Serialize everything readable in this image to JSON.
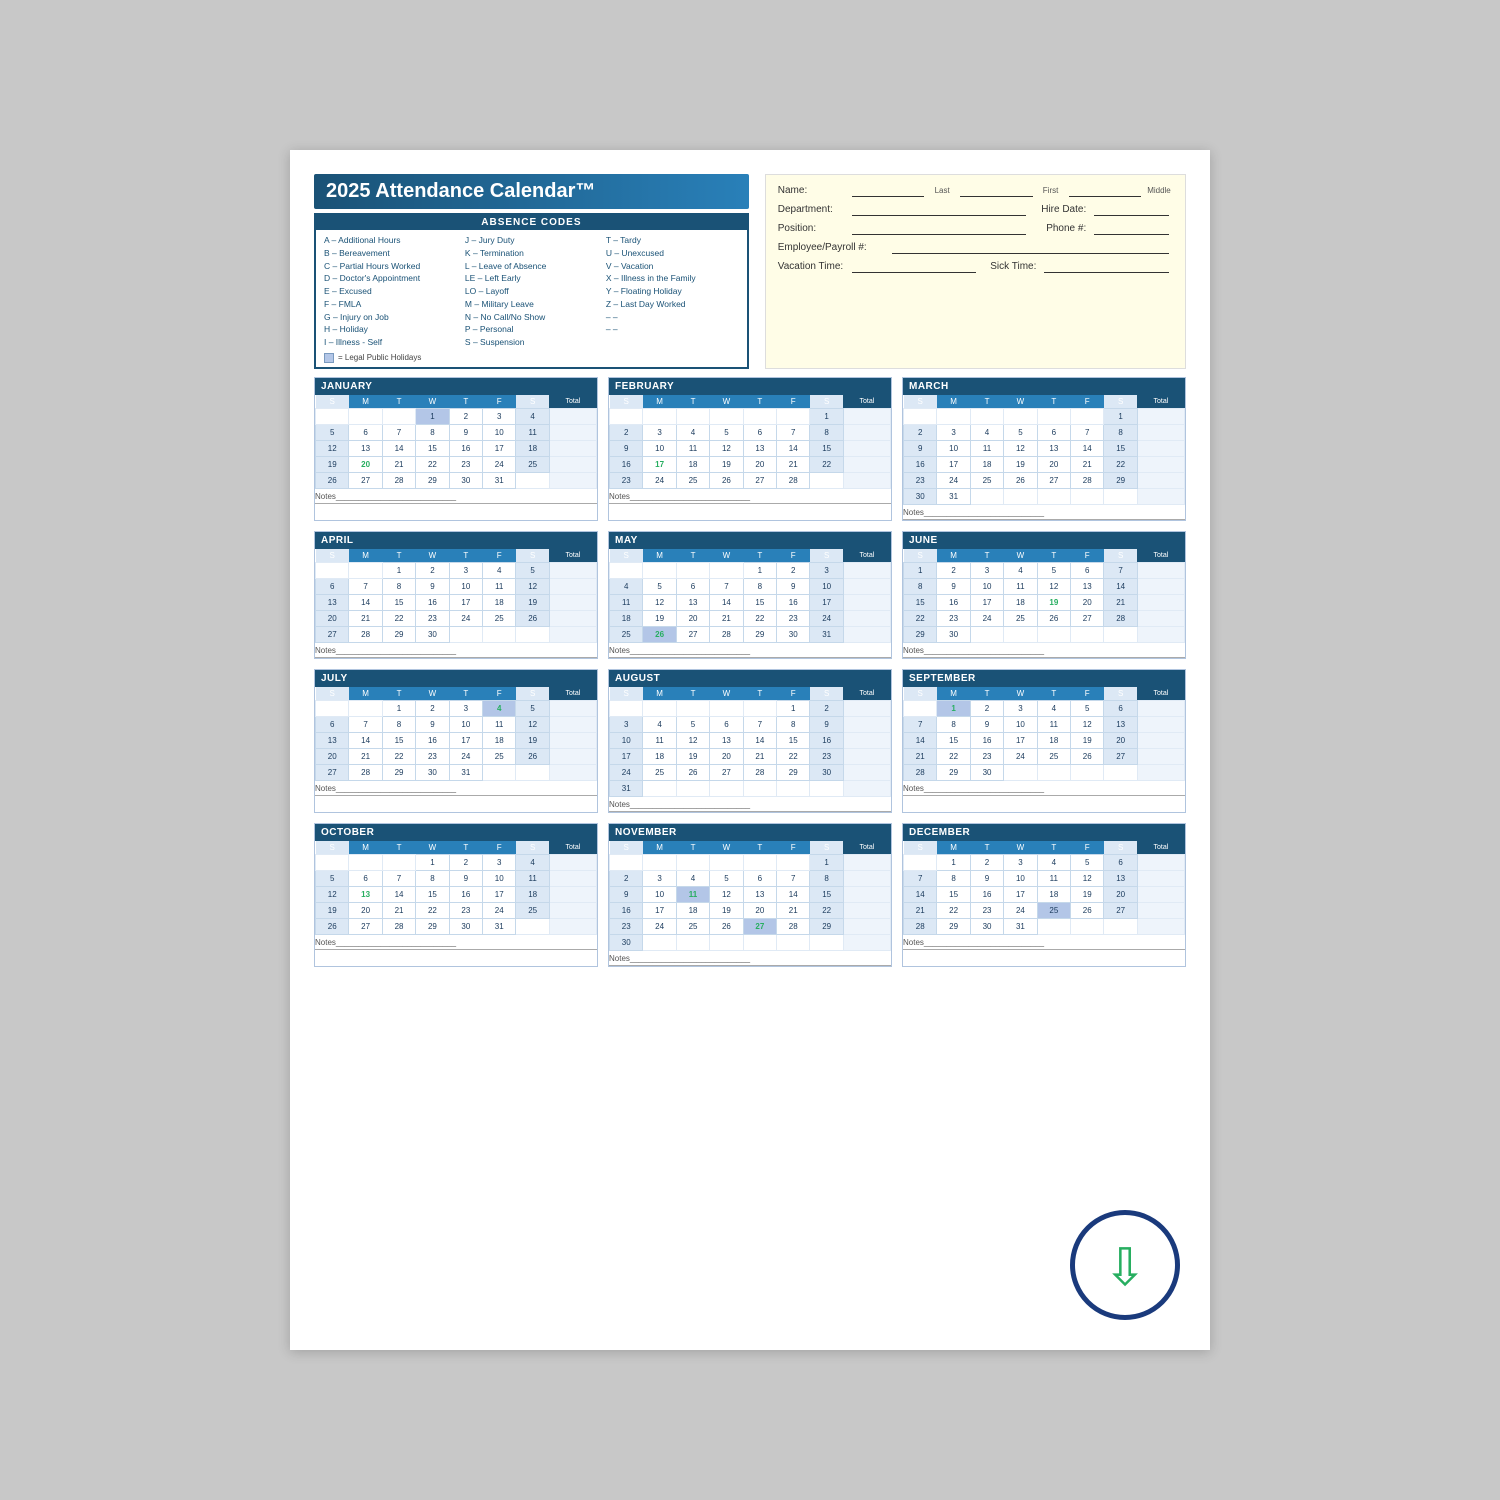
{
  "title": "2025 Attendance Calendar™",
  "absence_codes": {
    "header": "ABSENCE CODES",
    "col1": [
      "A – Additional Hours",
      "B – Bereavement",
      "C – Partial Hours Worked",
      "D – Doctor's Appointment",
      "E – Excused",
      "F – FMLA",
      "G – Injury on Job",
      "H – Holiday",
      "I  – Illness - Self"
    ],
    "col2": [
      "J  – Jury Duty",
      "K – Termination",
      "L  – Leave of Absence",
      "LE – Left Early",
      "LO – Layoff",
      "M – Military Leave",
      "N – No Call/No Show",
      "P  – Personal",
      "S  – Suspension"
    ],
    "col3": [
      "T – Tardy",
      "U – Unexcused",
      "V – Vacation",
      "X – Illness in the Family",
      "Y – Floating Holiday",
      "Z – Last Day Worked",
      "– –",
      "– –"
    ],
    "legend": "= Legal Public Holidays"
  },
  "form_fields": {
    "name_label": "Name:",
    "name_last": "Last",
    "name_first": "First",
    "name_middle": "Middle",
    "department_label": "Department:",
    "hire_date_label": "Hire Date:",
    "hire_date_placeholder": "   /   /",
    "position_label": "Position:",
    "phone_label": "Phone #:",
    "phone_placeholder": "(   )",
    "employee_label": "Employee/Payroll #:",
    "vacation_label": "Vacation Time:",
    "sick_label": "Sick Time:"
  },
  "months": [
    {
      "name": "JANUARY",
      "days_header": [
        "S",
        "M",
        "T",
        "W",
        "T",
        "F",
        "S",
        "Total"
      ],
      "weeks": [
        [
          "",
          "",
          "",
          "1",
          "2",
          "3",
          "4",
          ""
        ],
        [
          "5",
          "6",
          "7",
          "8",
          "9",
          "10",
          "11",
          ""
        ],
        [
          "12",
          "13",
          "14",
          "15",
          "16",
          "17",
          "18",
          ""
        ],
        [
          "19",
          "20",
          "21",
          "22",
          "23",
          "24",
          "25",
          ""
        ],
        [
          "26",
          "27",
          "28",
          "29",
          "30",
          "31",
          "",
          ""
        ]
      ],
      "holiday_days": [
        "1"
      ],
      "highlight_days": [
        "20"
      ],
      "notes": "Notes"
    },
    {
      "name": "FEBRUARY",
      "days_header": [
        "S",
        "M",
        "T",
        "W",
        "T",
        "F",
        "S",
        "Total"
      ],
      "weeks": [
        [
          "",
          "",
          "",
          "",
          "",
          "",
          "1",
          ""
        ],
        [
          "2",
          "3",
          "4",
          "5",
          "6",
          "7",
          "8",
          ""
        ],
        [
          "9",
          "10",
          "11",
          "12",
          "13",
          "14",
          "15",
          ""
        ],
        [
          "16",
          "17",
          "18",
          "19",
          "20",
          "21",
          "22",
          ""
        ],
        [
          "23",
          "24",
          "25",
          "26",
          "27",
          "28",
          "",
          ""
        ]
      ],
      "holiday_days": [],
      "highlight_days": [
        "17"
      ],
      "notes": "Notes"
    },
    {
      "name": "MARCH",
      "days_header": [
        "S",
        "M",
        "T",
        "W",
        "T",
        "F",
        "S",
        "Total"
      ],
      "weeks": [
        [
          "",
          "",
          "",
          "",
          "",
          "",
          "1",
          ""
        ],
        [
          "2",
          "3",
          "4",
          "5",
          "6",
          "7",
          "8",
          ""
        ],
        [
          "9",
          "10",
          "11",
          "12",
          "13",
          "14",
          "15",
          ""
        ],
        [
          "16",
          "17",
          "18",
          "19",
          "20",
          "21",
          "22",
          ""
        ],
        [
          "23",
          "24",
          "25",
          "26",
          "27",
          "28",
          "29",
          ""
        ],
        [
          "30",
          "31",
          "",
          "",
          "",
          "",
          "",
          ""
        ]
      ],
      "holiday_days": [],
      "highlight_days": [],
      "notes": "Notes"
    },
    {
      "name": "APRIL",
      "days_header": [
        "S",
        "M",
        "T",
        "W",
        "T",
        "F",
        "S",
        "Total"
      ],
      "weeks": [
        [
          "",
          "",
          "1",
          "2",
          "3",
          "4",
          "5",
          ""
        ],
        [
          "6",
          "7",
          "8",
          "9",
          "10",
          "11",
          "12",
          ""
        ],
        [
          "13",
          "14",
          "15",
          "16",
          "17",
          "18",
          "19",
          ""
        ],
        [
          "20",
          "21",
          "22",
          "23",
          "24",
          "25",
          "26",
          ""
        ],
        [
          "27",
          "28",
          "29",
          "30",
          "",
          "",
          "",
          ""
        ]
      ],
      "holiday_days": [],
      "highlight_days": [],
      "notes": "Notes"
    },
    {
      "name": "MAY",
      "days_header": [
        "S",
        "M",
        "T",
        "W",
        "T",
        "F",
        "S",
        "Total"
      ],
      "weeks": [
        [
          "",
          "",
          "",
          "",
          "1",
          "2",
          "3",
          ""
        ],
        [
          "4",
          "5",
          "6",
          "7",
          "8",
          "9",
          "10",
          ""
        ],
        [
          "11",
          "12",
          "13",
          "14",
          "15",
          "16",
          "17",
          ""
        ],
        [
          "18",
          "19",
          "20",
          "21",
          "22",
          "23",
          "24",
          ""
        ],
        [
          "25",
          "26",
          "27",
          "28",
          "29",
          "30",
          "31",
          ""
        ]
      ],
      "holiday_days": [
        "26"
      ],
      "highlight_days": [
        "26"
      ],
      "notes": "Notes"
    },
    {
      "name": "JUNE",
      "days_header": [
        "S",
        "M",
        "T",
        "W",
        "T",
        "F",
        "S",
        "Total"
      ],
      "weeks": [
        [
          "1",
          "2",
          "3",
          "4",
          "5",
          "6",
          "7",
          ""
        ],
        [
          "8",
          "9",
          "10",
          "11",
          "12",
          "13",
          "14",
          ""
        ],
        [
          "15",
          "16",
          "17",
          "18",
          "19",
          "20",
          "21",
          ""
        ],
        [
          "22",
          "23",
          "24",
          "25",
          "26",
          "27",
          "28",
          ""
        ],
        [
          "29",
          "30",
          "",
          "",
          "",
          "",
          "",
          ""
        ]
      ],
      "holiday_days": [],
      "highlight_days": [
        "19"
      ],
      "notes": "Notes"
    },
    {
      "name": "JULY",
      "days_header": [
        "S",
        "M",
        "T",
        "W",
        "T",
        "F",
        "S",
        "Total"
      ],
      "weeks": [
        [
          "",
          "",
          "1",
          "2",
          "3",
          "4",
          "5",
          ""
        ],
        [
          "6",
          "7",
          "8",
          "9",
          "10",
          "11",
          "12",
          ""
        ],
        [
          "13",
          "14",
          "15",
          "16",
          "17",
          "18",
          "19",
          ""
        ],
        [
          "20",
          "21",
          "22",
          "23",
          "24",
          "25",
          "26",
          ""
        ],
        [
          "27",
          "28",
          "29",
          "30",
          "31",
          "",
          "",
          ""
        ]
      ],
      "holiday_days": [
        "4"
      ],
      "highlight_days": [
        "4"
      ],
      "notes": "Notes"
    },
    {
      "name": "AUGUST",
      "days_header": [
        "S",
        "M",
        "T",
        "W",
        "T",
        "F",
        "S",
        "Total"
      ],
      "weeks": [
        [
          "",
          "",
          "",
          "",
          "",
          "1",
          "2",
          ""
        ],
        [
          "3",
          "4",
          "5",
          "6",
          "7",
          "8",
          "9",
          ""
        ],
        [
          "10",
          "11",
          "12",
          "13",
          "14",
          "15",
          "16",
          ""
        ],
        [
          "17",
          "18",
          "19",
          "20",
          "21",
          "22",
          "23",
          ""
        ],
        [
          "24",
          "25",
          "26",
          "27",
          "28",
          "29",
          "30",
          ""
        ],
        [
          "31",
          "",
          "",
          "",
          "",
          "",
          "",
          ""
        ]
      ],
      "holiday_days": [],
      "highlight_days": [],
      "notes": "Notes"
    },
    {
      "name": "SEPTEMBER",
      "days_header": [
        "S",
        "M",
        "T",
        "W",
        "T",
        "F",
        "S",
        "Total"
      ],
      "weeks": [
        [
          "",
          "1",
          "2",
          "3",
          "4",
          "5",
          "6",
          ""
        ],
        [
          "7",
          "8",
          "9",
          "10",
          "11",
          "12",
          "13",
          ""
        ],
        [
          "14",
          "15",
          "16",
          "17",
          "18",
          "19",
          "20",
          ""
        ],
        [
          "21",
          "22",
          "23",
          "24",
          "25",
          "26",
          "27",
          ""
        ],
        [
          "28",
          "29",
          "30",
          "",
          "",
          "",
          "",
          ""
        ]
      ],
      "holiday_days": [
        "1"
      ],
      "highlight_days": [
        "1"
      ],
      "notes": "Notes"
    },
    {
      "name": "OCTOBER",
      "days_header": [
        "S",
        "M",
        "T",
        "W",
        "T",
        "F",
        "S",
        "Total"
      ],
      "weeks": [
        [
          "",
          "",
          "",
          "1",
          "2",
          "3",
          "4",
          ""
        ],
        [
          "5",
          "6",
          "7",
          "8",
          "9",
          "10",
          "11",
          ""
        ],
        [
          "12",
          "13",
          "14",
          "15",
          "16",
          "17",
          "18",
          ""
        ],
        [
          "19",
          "20",
          "21",
          "22",
          "23",
          "24",
          "25",
          ""
        ],
        [
          "26",
          "27",
          "28",
          "29",
          "30",
          "31",
          "",
          ""
        ]
      ],
      "holiday_days": [],
      "highlight_days": [
        "13"
      ],
      "notes": "Notes"
    },
    {
      "name": "NOVEMBER",
      "days_header": [
        "S",
        "M",
        "T",
        "W",
        "T",
        "F",
        "S",
        "Total"
      ],
      "weeks": [
        [
          "",
          "",
          "",
          "",
          "",
          "",
          "1",
          ""
        ],
        [
          "2",
          "3",
          "4",
          "5",
          "6",
          "7",
          "8",
          ""
        ],
        [
          "9",
          "10",
          "11",
          "12",
          "13",
          "14",
          "15",
          ""
        ],
        [
          "16",
          "17",
          "18",
          "19",
          "20",
          "21",
          "22",
          ""
        ],
        [
          "23",
          "24",
          "25",
          "26",
          "27",
          "28",
          "29",
          ""
        ],
        [
          "30",
          "",
          "",
          "",
          "",
          "",
          "",
          ""
        ]
      ],
      "holiday_days": [
        "11",
        "27"
      ],
      "highlight_days": [
        "11",
        "27"
      ],
      "notes": "Notes"
    },
    {
      "name": "DECEMBER",
      "days_header": [
        "S",
        "M",
        "T",
        "W",
        "T",
        "F",
        "S",
        "Total"
      ],
      "weeks": [
        [
          "",
          "1",
          "2",
          "3",
          "4",
          "5",
          "6",
          ""
        ],
        [
          "7",
          "8",
          "9",
          "10",
          "11",
          "12",
          "13",
          ""
        ],
        [
          "14",
          "15",
          "16",
          "17",
          "18",
          "19",
          "20",
          ""
        ],
        [
          "21",
          "22",
          "23",
          "24",
          "25",
          "26",
          "27",
          ""
        ],
        [
          "28",
          "29",
          "30",
          "31",
          "",
          "",
          "",
          ""
        ]
      ],
      "holiday_days": [
        "25"
      ],
      "highlight_days": [],
      "notes": "Notes"
    }
  ],
  "download_icon": "⬇"
}
